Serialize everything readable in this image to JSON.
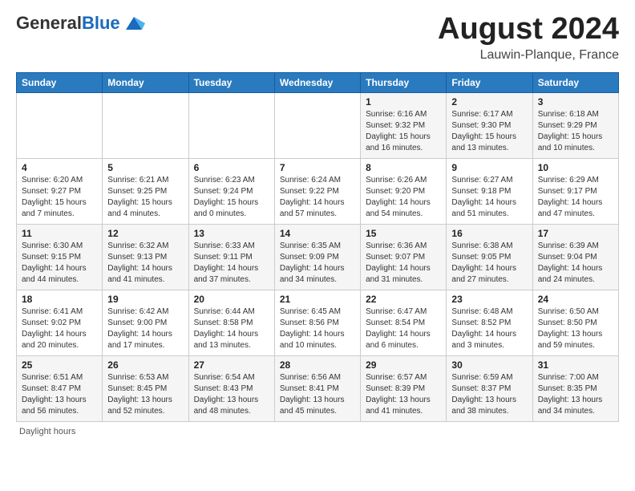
{
  "header": {
    "logo_general": "General",
    "logo_blue": "Blue",
    "month_title": "August 2024",
    "location": "Lauwin-Planque, France"
  },
  "days_of_week": [
    "Sunday",
    "Monday",
    "Tuesday",
    "Wednesday",
    "Thursday",
    "Friday",
    "Saturday"
  ],
  "weeks": [
    [
      {
        "day": "",
        "info": ""
      },
      {
        "day": "",
        "info": ""
      },
      {
        "day": "",
        "info": ""
      },
      {
        "day": "",
        "info": ""
      },
      {
        "day": "1",
        "info": "Sunrise: 6:16 AM\nSunset: 9:32 PM\nDaylight: 15 hours and 16 minutes."
      },
      {
        "day": "2",
        "info": "Sunrise: 6:17 AM\nSunset: 9:30 PM\nDaylight: 15 hours and 13 minutes."
      },
      {
        "day": "3",
        "info": "Sunrise: 6:18 AM\nSunset: 9:29 PM\nDaylight: 15 hours and 10 minutes."
      }
    ],
    [
      {
        "day": "4",
        "info": "Sunrise: 6:20 AM\nSunset: 9:27 PM\nDaylight: 15 hours and 7 minutes."
      },
      {
        "day": "5",
        "info": "Sunrise: 6:21 AM\nSunset: 9:25 PM\nDaylight: 15 hours and 4 minutes."
      },
      {
        "day": "6",
        "info": "Sunrise: 6:23 AM\nSunset: 9:24 PM\nDaylight: 15 hours and 0 minutes."
      },
      {
        "day": "7",
        "info": "Sunrise: 6:24 AM\nSunset: 9:22 PM\nDaylight: 14 hours and 57 minutes."
      },
      {
        "day": "8",
        "info": "Sunrise: 6:26 AM\nSunset: 9:20 PM\nDaylight: 14 hours and 54 minutes."
      },
      {
        "day": "9",
        "info": "Sunrise: 6:27 AM\nSunset: 9:18 PM\nDaylight: 14 hours and 51 minutes."
      },
      {
        "day": "10",
        "info": "Sunrise: 6:29 AM\nSunset: 9:17 PM\nDaylight: 14 hours and 47 minutes."
      }
    ],
    [
      {
        "day": "11",
        "info": "Sunrise: 6:30 AM\nSunset: 9:15 PM\nDaylight: 14 hours and 44 minutes."
      },
      {
        "day": "12",
        "info": "Sunrise: 6:32 AM\nSunset: 9:13 PM\nDaylight: 14 hours and 41 minutes."
      },
      {
        "day": "13",
        "info": "Sunrise: 6:33 AM\nSunset: 9:11 PM\nDaylight: 14 hours and 37 minutes."
      },
      {
        "day": "14",
        "info": "Sunrise: 6:35 AM\nSunset: 9:09 PM\nDaylight: 14 hours and 34 minutes."
      },
      {
        "day": "15",
        "info": "Sunrise: 6:36 AM\nSunset: 9:07 PM\nDaylight: 14 hours and 31 minutes."
      },
      {
        "day": "16",
        "info": "Sunrise: 6:38 AM\nSunset: 9:05 PM\nDaylight: 14 hours and 27 minutes."
      },
      {
        "day": "17",
        "info": "Sunrise: 6:39 AM\nSunset: 9:04 PM\nDaylight: 14 hours and 24 minutes."
      }
    ],
    [
      {
        "day": "18",
        "info": "Sunrise: 6:41 AM\nSunset: 9:02 PM\nDaylight: 14 hours and 20 minutes."
      },
      {
        "day": "19",
        "info": "Sunrise: 6:42 AM\nSunset: 9:00 PM\nDaylight: 14 hours and 17 minutes."
      },
      {
        "day": "20",
        "info": "Sunrise: 6:44 AM\nSunset: 8:58 PM\nDaylight: 14 hours and 13 minutes."
      },
      {
        "day": "21",
        "info": "Sunrise: 6:45 AM\nSunset: 8:56 PM\nDaylight: 14 hours and 10 minutes."
      },
      {
        "day": "22",
        "info": "Sunrise: 6:47 AM\nSunset: 8:54 PM\nDaylight: 14 hours and 6 minutes."
      },
      {
        "day": "23",
        "info": "Sunrise: 6:48 AM\nSunset: 8:52 PM\nDaylight: 14 hours and 3 minutes."
      },
      {
        "day": "24",
        "info": "Sunrise: 6:50 AM\nSunset: 8:50 PM\nDaylight: 13 hours and 59 minutes."
      }
    ],
    [
      {
        "day": "25",
        "info": "Sunrise: 6:51 AM\nSunset: 8:47 PM\nDaylight: 13 hours and 56 minutes."
      },
      {
        "day": "26",
        "info": "Sunrise: 6:53 AM\nSunset: 8:45 PM\nDaylight: 13 hours and 52 minutes."
      },
      {
        "day": "27",
        "info": "Sunrise: 6:54 AM\nSunset: 8:43 PM\nDaylight: 13 hours and 48 minutes."
      },
      {
        "day": "28",
        "info": "Sunrise: 6:56 AM\nSunset: 8:41 PM\nDaylight: 13 hours and 45 minutes."
      },
      {
        "day": "29",
        "info": "Sunrise: 6:57 AM\nSunset: 8:39 PM\nDaylight: 13 hours and 41 minutes."
      },
      {
        "day": "30",
        "info": "Sunrise: 6:59 AM\nSunset: 8:37 PM\nDaylight: 13 hours and 38 minutes."
      },
      {
        "day": "31",
        "info": "Sunrise: 7:00 AM\nSunset: 8:35 PM\nDaylight: 13 hours and 34 minutes."
      }
    ]
  ],
  "footer": {
    "note": "Daylight hours"
  }
}
